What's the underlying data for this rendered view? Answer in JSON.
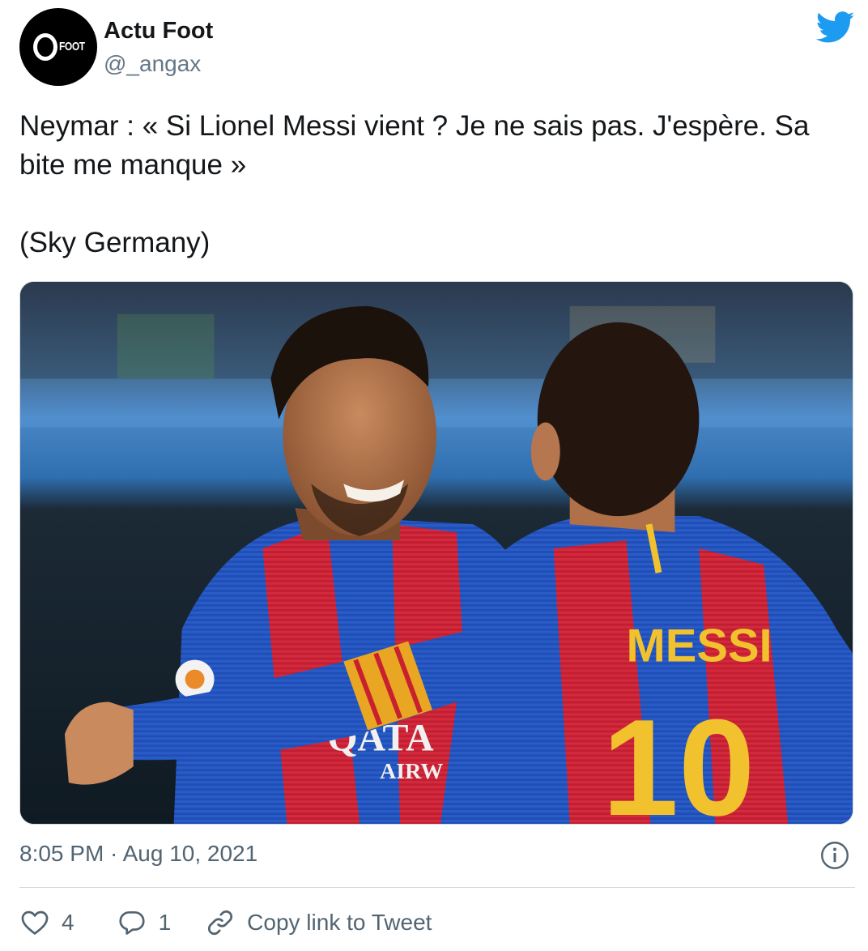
{
  "author": {
    "display_name": "Actu Foot",
    "handle": "@_angax",
    "avatar_logo_text": "FOOT"
  },
  "tweet": {
    "lines": [
      "Neymar : « Si Lionel Messi vient ? Je ne sais pas. J'espère. Sa bite me manque »",
      "(Sky Germany)"
    ],
    "media": {
      "shirt_text_name": "MESSI",
      "shirt_text_number": "10",
      "sponsor_line1": "QATA",
      "sponsor_line2": "AIRW"
    },
    "timestamp": "8:05 PM · Aug 10, 2021"
  },
  "actions": {
    "like_count": "4",
    "reply_count": "1",
    "copy_link_label": "Copy link to Tweet"
  },
  "icons": {
    "brand": "twitter-bird-icon",
    "info": "info-icon",
    "like": "heart-icon",
    "reply": "reply-bubble-icon",
    "link": "link-icon"
  },
  "colors": {
    "brand": "#1d9bf0",
    "secondary_text": "#536471",
    "primary_text": "#14171a"
  }
}
